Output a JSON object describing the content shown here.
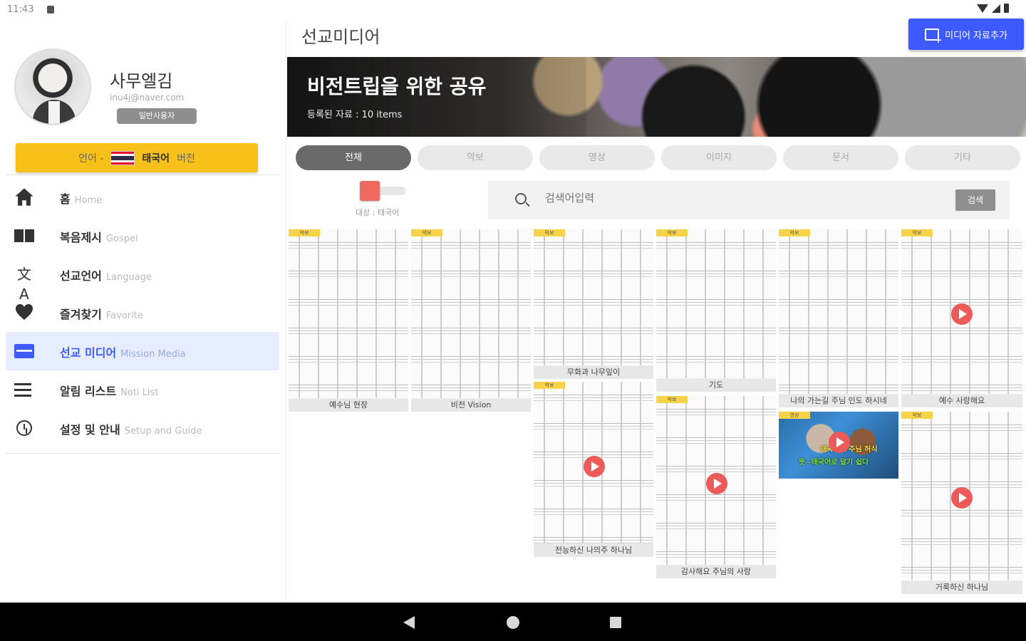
{
  "status_bar": {
    "time": "11:43"
  },
  "sidebar": {
    "user": {
      "name": "사무엘김",
      "email": "inu4j@naver.com",
      "badge": "일반사용자"
    },
    "language_button": {
      "prefix": "언어 -",
      "language": "태국어",
      "suffix": "버전"
    },
    "items": [
      {
        "label": "홈",
        "sub": "Home",
        "icon": "home-icon"
      },
      {
        "label": "복음제시",
        "sub": "Gospel",
        "icon": "book-icon"
      },
      {
        "label": "선교언어",
        "sub": "Language",
        "icon": "translate-icon"
      },
      {
        "label": "즐겨찾기",
        "sub": "Favorite",
        "icon": "heart-icon"
      },
      {
        "label": "선교 미디어",
        "sub": "Mission Media",
        "icon": "media-icon",
        "active": true
      },
      {
        "label": "알림 리스트",
        "sub": "Noti List",
        "icon": "list-icon"
      },
      {
        "label": "설정 및 안내",
        "sub": "Setup and Guide",
        "icon": "settings-clock-icon"
      }
    ]
  },
  "header": {
    "title": "선교미디어",
    "add_button": "미디어 자료추가"
  },
  "banner": {
    "title": "비전트립을 위한 공유",
    "subtitle": "등록된 자료 : 10 items"
  },
  "tabs": [
    "전체",
    "악보",
    "영상",
    "이미지",
    "문서",
    "기타"
  ],
  "filter": {
    "label": "대상 : 태국어"
  },
  "search": {
    "placeholder": "검색어입력",
    "button": "검색"
  },
  "cards": [
    {
      "tag": "악보",
      "caption": "예수님 현장"
    },
    {
      "tag": "악보",
      "caption": "비전 Vision"
    },
    {
      "tag": "악보",
      "caption": "무화과 나무잎이"
    },
    {
      "tag": "악보",
      "caption": "기도"
    },
    {
      "tag": "악보",
      "caption": "나의 가는길 주님 인도 하시네"
    },
    {
      "tag": "악보",
      "caption": "예수 사랑해요"
    },
    {
      "tag": "악보",
      "caption": "전능하신 나의주 하나님"
    },
    {
      "tag": "악보",
      "caption": "감사해요 주님의 사랑"
    },
    {
      "tag": "영상",
      "caption": "",
      "video_text_1": "태국어로 주님 허식",
      "video_text_2": "뜻~태국어로 알기 쉽다"
    },
    {
      "tag": "악보",
      "caption": "거룩하신 하나님"
    }
  ],
  "colors": {
    "accent": "#3d5afe",
    "lang_button": "#f7c11a",
    "tag": "#f7d34a",
    "play": "#ec5a5a"
  }
}
